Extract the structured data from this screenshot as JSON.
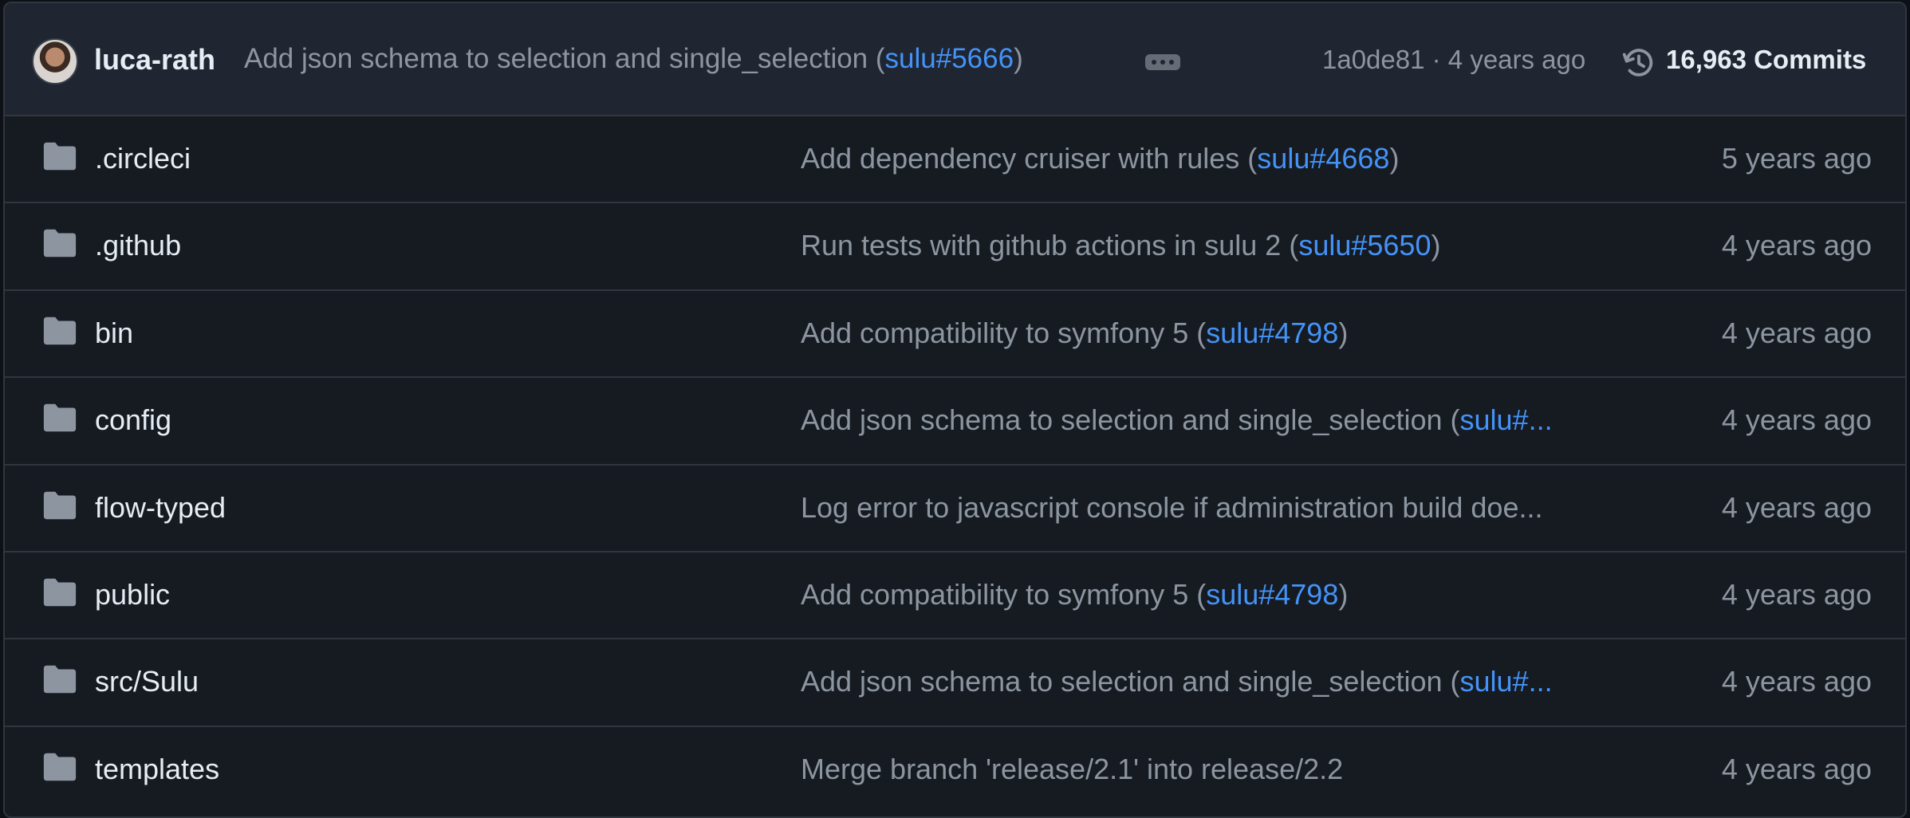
{
  "header": {
    "author": "luca-rath",
    "message_prefix": "Add json schema to selection and single_selection (",
    "message_link": "sulu#5666",
    "message_suffix": ")",
    "meta": "1a0de81 · 4 years ago",
    "commits_label": "16,963 Commits",
    "icons": {
      "avatar": "avatar",
      "more": "ellipsis-icon",
      "history": "history-icon"
    }
  },
  "rows": [
    {
      "name": ".circleci",
      "msg_prefix": "Add dependency cruiser with rules (",
      "msg_link": "sulu#4668",
      "msg_suffix": ")",
      "time": "5 years ago"
    },
    {
      "name": ".github",
      "msg_prefix": "Run tests with github actions in sulu 2 (",
      "msg_link": "sulu#5650",
      "msg_suffix": ")",
      "time": "4 years ago"
    },
    {
      "name": "bin",
      "msg_prefix": "Add compatibility to symfony 5 (",
      "msg_link": "sulu#4798",
      "msg_suffix": ")",
      "time": "4 years ago"
    },
    {
      "name": "config",
      "msg_prefix": "Add json schema to selection and single_selection (",
      "msg_link": "sulu#...",
      "msg_suffix": "",
      "time": "4 years ago"
    },
    {
      "name": "flow-typed",
      "msg_prefix": "Log error to javascript console if administration build doe...",
      "msg_link": "",
      "msg_suffix": "",
      "time": "4 years ago"
    },
    {
      "name": "public",
      "msg_prefix": "Add compatibility to symfony 5 (",
      "msg_link": "sulu#4798",
      "msg_suffix": ")",
      "time": "4 years ago"
    },
    {
      "name": "src/Sulu",
      "msg_prefix": "Add json schema to selection and single_selection (",
      "msg_link": "sulu#...",
      "msg_suffix": "",
      "time": "4 years ago"
    },
    {
      "name": "templates",
      "msg_prefix": "Merge branch 'release/2.1' into release/2.2",
      "msg_link": "",
      "msg_suffix": "",
      "time": "4 years ago"
    }
  ],
  "colors": {
    "background": "#161b22",
    "header": "#1f2632",
    "text": "#e6edf3",
    "muted": "#8d96a0",
    "link": "#4493f8",
    "folder": "#8d96a0",
    "border": "#30363d"
  }
}
